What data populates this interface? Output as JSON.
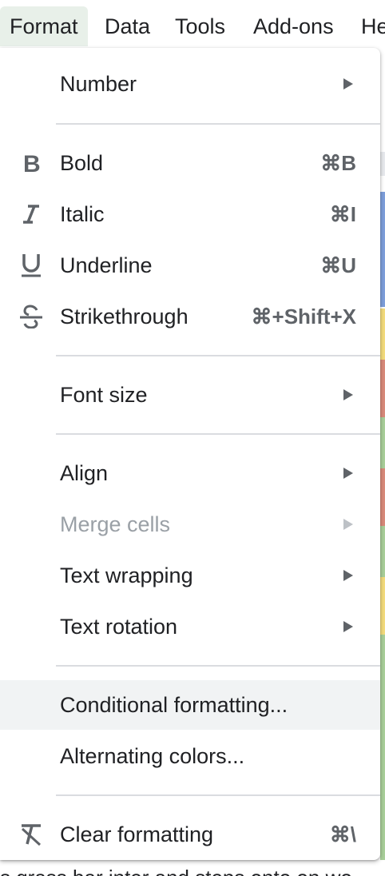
{
  "menubar": {
    "items": [
      "Format",
      "Data",
      "Tools",
      "Add-ons",
      "He"
    ]
  },
  "menu": {
    "number": "Number",
    "bold": "Bold",
    "bold_shortcut": "⌘B",
    "italic": "Italic",
    "italic_shortcut": "⌘I",
    "underline": "Underline",
    "underline_shortcut": "⌘U",
    "strikethrough": "Strikethrough",
    "strikethrough_shortcut": "⌘+Shift+X",
    "font_size": "Font size",
    "align": "Align",
    "merge_cells": "Merge cells",
    "text_wrapping": "Text wrapping",
    "text_rotation": "Text rotation",
    "conditional_formatting": "Conditional formatting...",
    "alternating_colors": "Alternating colors...",
    "clear_formatting": "Clear formatting",
    "clear_formatting_shortcut": "⌘\\"
  },
  "background": {
    "bottom_text": "s grass bar inter and steps onto on wo"
  },
  "icons": {
    "bold": "bold-icon",
    "italic": "italic-icon",
    "underline": "underline-icon",
    "strikethrough": "strikethrough-icon",
    "clear_formatting": "clear-formatting-icon",
    "submenu": "submenu-arrow-icon"
  },
  "colors": {
    "hover": "#f1f3f4",
    "active_menu": "#e8f0e9",
    "disabled_text": "#9aa0a6",
    "strip_blue": "#7e9fdb",
    "strip_yellow": "#f3dc7d",
    "strip_red": "#d98b7b",
    "strip_green": "#a9cf9a"
  }
}
